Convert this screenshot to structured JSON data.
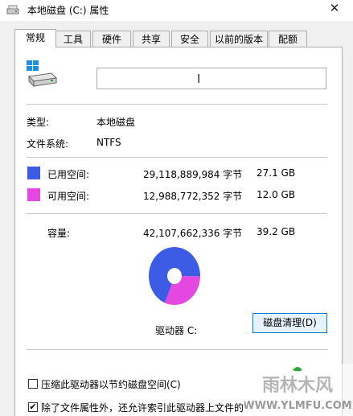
{
  "window": {
    "title": "本地磁盘 (C:) 属性",
    "close_glyph": "✕"
  },
  "tabs": [
    {
      "label": "常规",
      "active": true
    },
    {
      "label": "工具"
    },
    {
      "label": "硬件"
    },
    {
      "label": "共享"
    },
    {
      "label": "安全"
    },
    {
      "label": "以前的版本"
    },
    {
      "label": "配额"
    }
  ],
  "general": {
    "drive_name_value": "",
    "type_label": "类型:",
    "type_value": "本地磁盘",
    "fs_label": "文件系统:",
    "fs_value": "NTFS",
    "used": {
      "label": "已用空间:",
      "bytes": "29,118,889,984 字节",
      "size": "27.1 GB",
      "color": "#3c5ce6"
    },
    "free": {
      "label": "可用空间:",
      "bytes": "12,988,772,352 字节",
      "size": "12.0 GB",
      "color": "#e448e0"
    },
    "capacity": {
      "label": "容量:",
      "bytes": "42,107,662,336 字节",
      "size": "39.2 GB"
    },
    "drive_label": "驱动器 C:",
    "cleanup_button": "磁盘清理(D)",
    "compress_checkbox": {
      "label": "压缩此驱动器以节约磁盘空间(C)",
      "checked": false
    },
    "index_checkbox": {
      "label": "除了文件属性外，还允许索引此驱动器上文件的",
      "checked": true
    }
  },
  "watermark": {
    "text": "雨林木风",
    "url": "WWW.YLMFU.COM"
  }
}
